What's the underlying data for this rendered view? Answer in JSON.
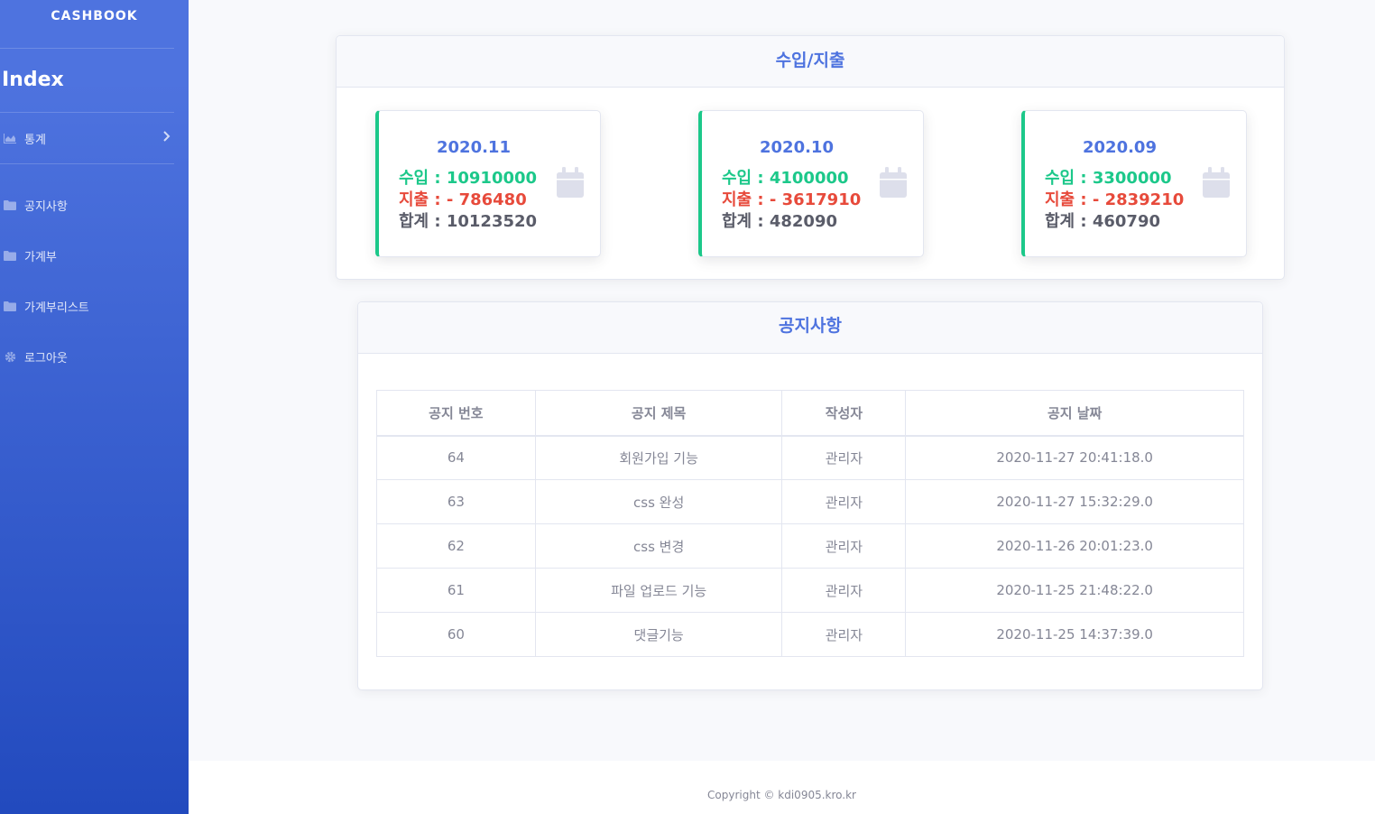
{
  "sidebar": {
    "brand": "CASHBOOK",
    "heading": "Index",
    "items": [
      {
        "label": "통계",
        "icon": "chart-area-icon"
      },
      {
        "label": "공지사항",
        "icon": "folder-icon"
      },
      {
        "label": "가계부",
        "icon": "folder-icon"
      },
      {
        "label": "가계부리스트",
        "icon": "folder-icon"
      },
      {
        "label": "로그아웃",
        "icon": "gear-icon"
      }
    ]
  },
  "income": {
    "title": "수입/지출",
    "cards": [
      {
        "month": "2020.11",
        "income": "수입 : 10910000",
        "expense": "지출 : - 786480",
        "total": "합계 : 10123520"
      },
      {
        "month": "2020.10",
        "income": "수입 : 4100000",
        "expense": "지출 : - 3617910",
        "total": "합계 : 482090"
      },
      {
        "month": "2020.09",
        "income": "수입 : 3300000",
        "expense": "지출 : - 2839210",
        "total": "합계 : 460790"
      }
    ]
  },
  "notice": {
    "title": "공지사항",
    "columns": [
      "공지 번호",
      "공지 제목",
      "작성자",
      "공지 날짜"
    ],
    "rows": [
      [
        "64",
        "회원가입 기능",
        "관리자",
        "2020-11-27 20:41:18.0"
      ],
      [
        "63",
        "css 완성",
        "관리자",
        "2020-11-27 15:32:29.0"
      ],
      [
        "62",
        "css 변경",
        "관리자",
        "2020-11-26 20:01:23.0"
      ],
      [
        "61",
        "파일 업로드 기능",
        "관리자",
        "2020-11-25 21:48:22.0"
      ],
      [
        "60",
        "댓글기능",
        "관리자",
        "2020-11-25 14:37:39.0"
      ]
    ]
  },
  "footer": {
    "copyright": "Copyright © kdi0905.kro.kr"
  },
  "colors": {
    "primary": "#4e73df",
    "income": "#1cc88a",
    "expense": "#e74a3b",
    "total": "#5a5c69"
  }
}
